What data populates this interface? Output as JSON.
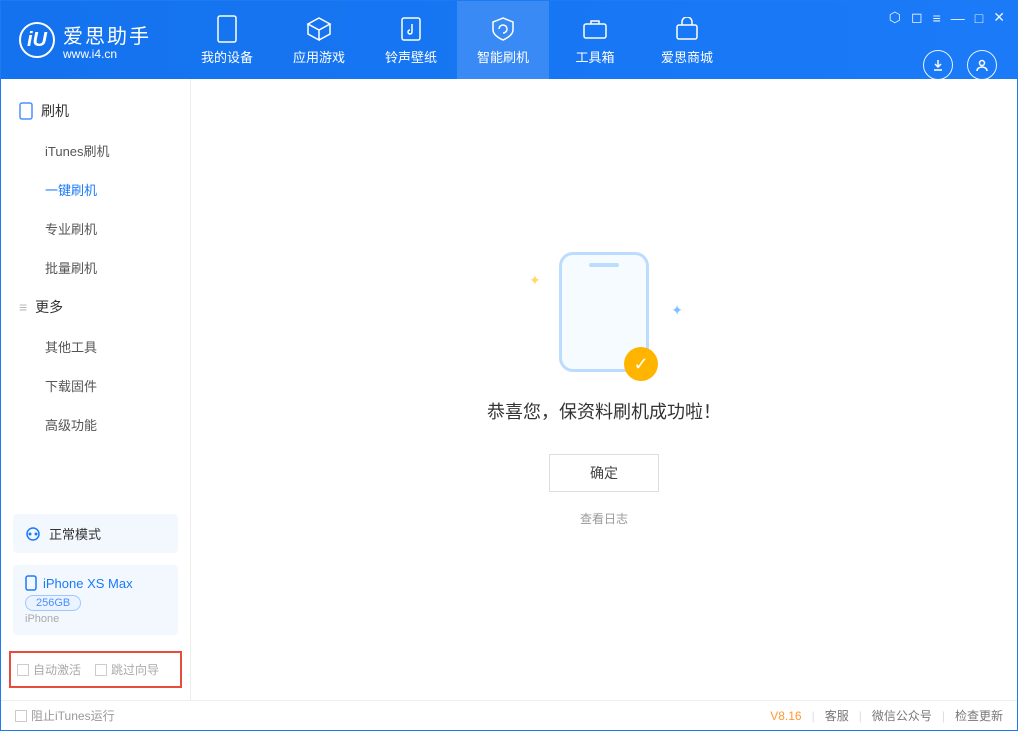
{
  "app": {
    "name": "爱思助手",
    "url": "www.i4.cn"
  },
  "header": {
    "tabs": [
      {
        "label": "我的设备"
      },
      {
        "label": "应用游戏"
      },
      {
        "label": "铃声壁纸"
      },
      {
        "label": "智能刷机"
      },
      {
        "label": "工具箱"
      },
      {
        "label": "爱思商城"
      }
    ]
  },
  "sidebar": {
    "section1": {
      "title": "刷机",
      "items": [
        "iTunes刷机",
        "一键刷机",
        "专业刷机",
        "批量刷机"
      ]
    },
    "section2": {
      "title": "更多",
      "items": [
        "其他工具",
        "下载固件",
        "高级功能"
      ]
    },
    "mode": "正常模式",
    "device": {
      "name": "iPhone XS Max",
      "storage": "256GB",
      "type": "iPhone"
    },
    "opts": {
      "auto_activate": "自动激活",
      "skip_guide": "跳过向导"
    }
  },
  "main": {
    "success_msg": "恭喜您，保资料刷机成功啦！",
    "ok": "确定",
    "view_log": "查看日志"
  },
  "status": {
    "block_itunes": "阻止iTunes运行",
    "version": "V8.16",
    "links": [
      "客服",
      "微信公众号",
      "检查更新"
    ]
  }
}
